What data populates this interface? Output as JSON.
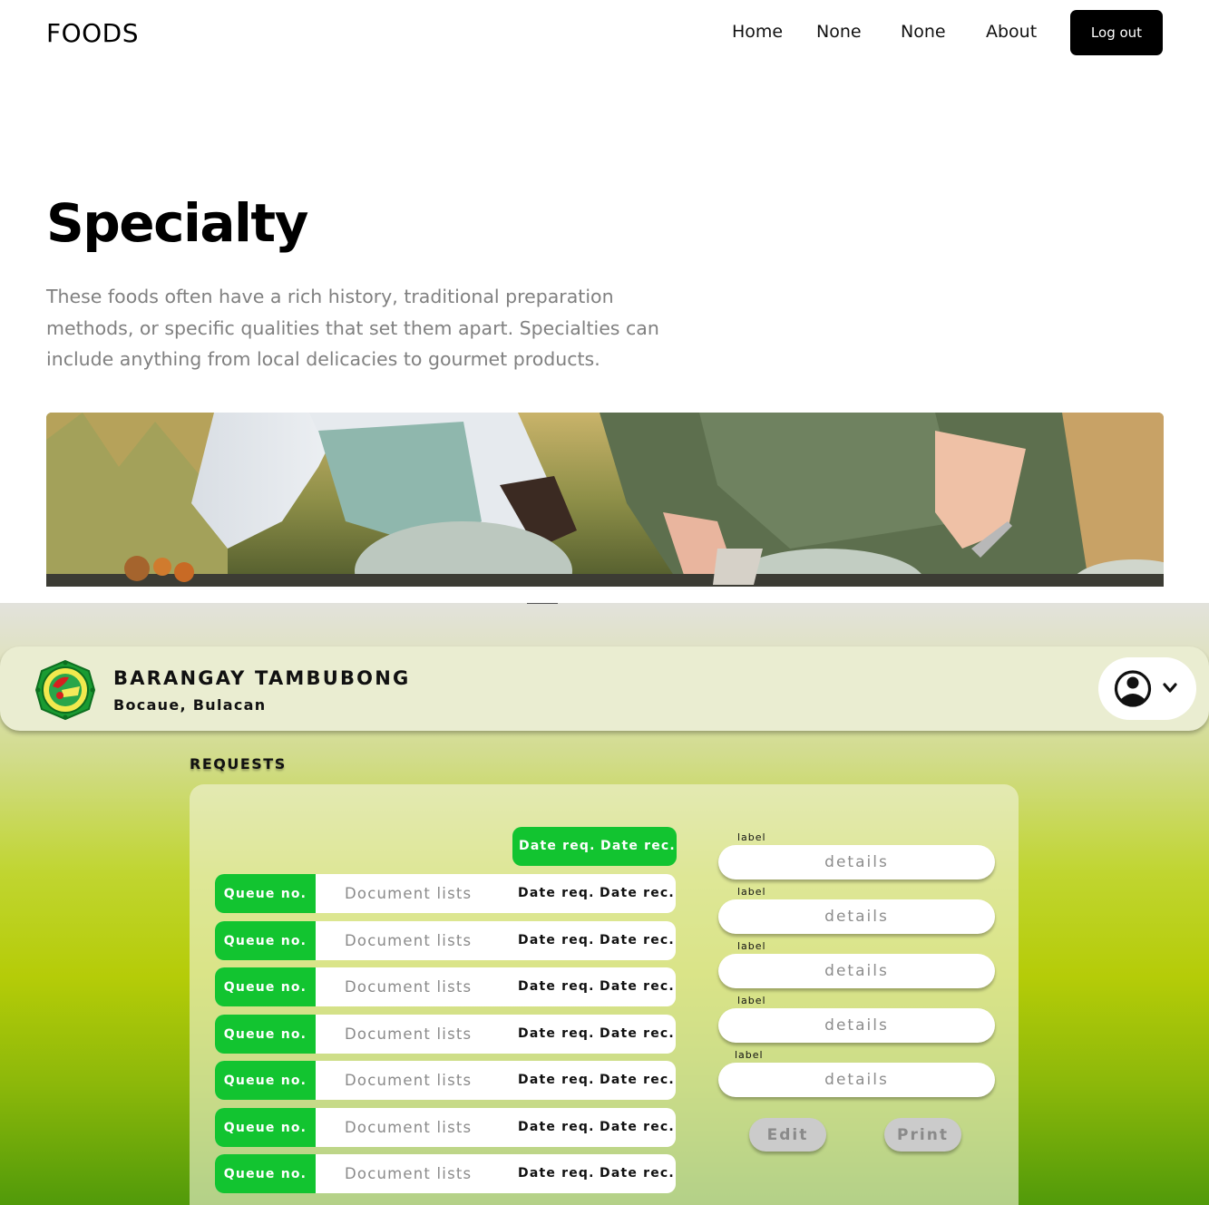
{
  "site": {
    "brand": "FOODS",
    "nav": [
      "Home",
      "None",
      "None",
      "About"
    ],
    "logout_label": "Log out"
  },
  "hero": {
    "title": "Specialty",
    "description": "These foods often have a rich history, traditional preparation methods, or specific qualities that set them apart. Specialties can include anything from local delicacies to gourmet products."
  },
  "app": {
    "org_name": "BARANGAY TAMBUBONG",
    "org_location": "Bocaue, Bulacan",
    "user_menu_icons": [
      "user-circle-icon",
      "chevron-down-icon"
    ],
    "section_title": "REQUESTS",
    "table_header": {
      "date_requested": "Date req.",
      "date_received": "Date rec."
    },
    "rows": [
      {
        "queue": "Queue no.",
        "document": "Document lists",
        "date_requested": "Date req.",
        "date_received": "Date rec."
      },
      {
        "queue": "Queue no.",
        "document": "Document lists",
        "date_requested": "Date req.",
        "date_received": "Date rec."
      },
      {
        "queue": "Queue no.",
        "document": "Document lists",
        "date_requested": "Date req.",
        "date_received": "Date rec."
      },
      {
        "queue": "Queue no.",
        "document": "Document lists",
        "date_requested": "Date req.",
        "date_received": "Date rec."
      },
      {
        "queue": "Queue no.",
        "document": "Document lists",
        "date_requested": "Date req.",
        "date_received": "Date rec."
      },
      {
        "queue": "Queue no.",
        "document": "Document lists",
        "date_requested": "Date req.",
        "date_received": "Date rec."
      },
      {
        "queue": "Queue no.",
        "document": "Document lists",
        "date_requested": "Date req.",
        "date_received": "Date rec."
      }
    ],
    "fields": [
      {
        "label": "label",
        "value": "details"
      },
      {
        "label": "label",
        "value": "details"
      },
      {
        "label": "label",
        "value": "details"
      },
      {
        "label": "label",
        "value": "details"
      },
      {
        "label": "label",
        "value": "details"
      }
    ],
    "edit_label": "Edit",
    "print_label": "Print"
  },
  "colors": {
    "accent_green": "#12c430",
    "header_bg": "#eaedd1",
    "button_dark": "#000000"
  }
}
